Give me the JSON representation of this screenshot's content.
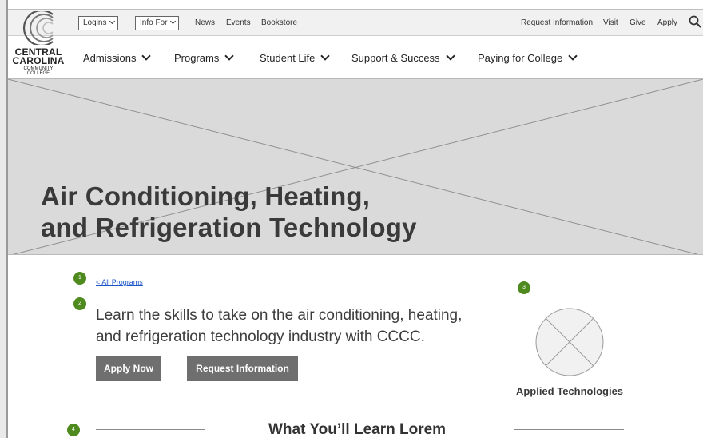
{
  "utility": {
    "logins": "Logins",
    "info_for": "Info For",
    "news": "News",
    "events": "Events",
    "bookstore": "Bookstore",
    "request_information": "Request Information",
    "visit": "Visit",
    "give": "Give",
    "apply": "Apply",
    "search_icon": "search-icon"
  },
  "logo": {
    "line1": "CENTRAL",
    "line2": "CAROLINA",
    "line3": "COMMUNITY",
    "line4": "COLLEGE"
  },
  "nav": {
    "items": [
      {
        "label": "Admissions"
      },
      {
        "label": "Programs"
      },
      {
        "label": "Student Life"
      },
      {
        "label": "Support & Success"
      },
      {
        "label": "Paying for College"
      }
    ]
  },
  "hero": {
    "title_line1": "Air Conditioning, Heating,",
    "title_line2": "and Refrigeration Technology"
  },
  "markers": [
    "1",
    "2",
    "3",
    "4"
  ],
  "breadcrumb": "< All Programs",
  "intro": {
    "line1": "Learn the skills to take on the air conditioning, heating,",
    "line2": "and refrigeration technology industry with CCCC."
  },
  "buttons": {
    "apply_now": "Apply Now",
    "request_information": "Request Information"
  },
  "sidebar": {
    "label": "Applied Technologies"
  },
  "section": {
    "title": "What You’ll Learn Lorem"
  },
  "colors": {
    "marker": "#4e8a1e",
    "button": "#6f6f6f",
    "hero_placeholder": "#dadada",
    "link": "#1a55c9"
  }
}
